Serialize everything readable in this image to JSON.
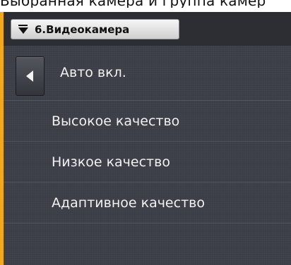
{
  "top_text": "Выбранная камера и группа камер",
  "header": {
    "camera_button_label": "6.Видеокамера"
  },
  "current_mode": {
    "label": "Авто вкл."
  },
  "quality_options": [
    {
      "label": "Высокое качество"
    },
    {
      "label": "Низкое качество"
    },
    {
      "label": "Адаптивное качество"
    }
  ],
  "colors": {
    "frame_accent": "#f0a81e",
    "panel_background": "#3b3e47",
    "header_background": "#2c2e33",
    "text_light": "#f1f1f1"
  },
  "icons": {
    "camera_dropdown": "down-caret-icon",
    "back": "left-triangle-icon"
  }
}
